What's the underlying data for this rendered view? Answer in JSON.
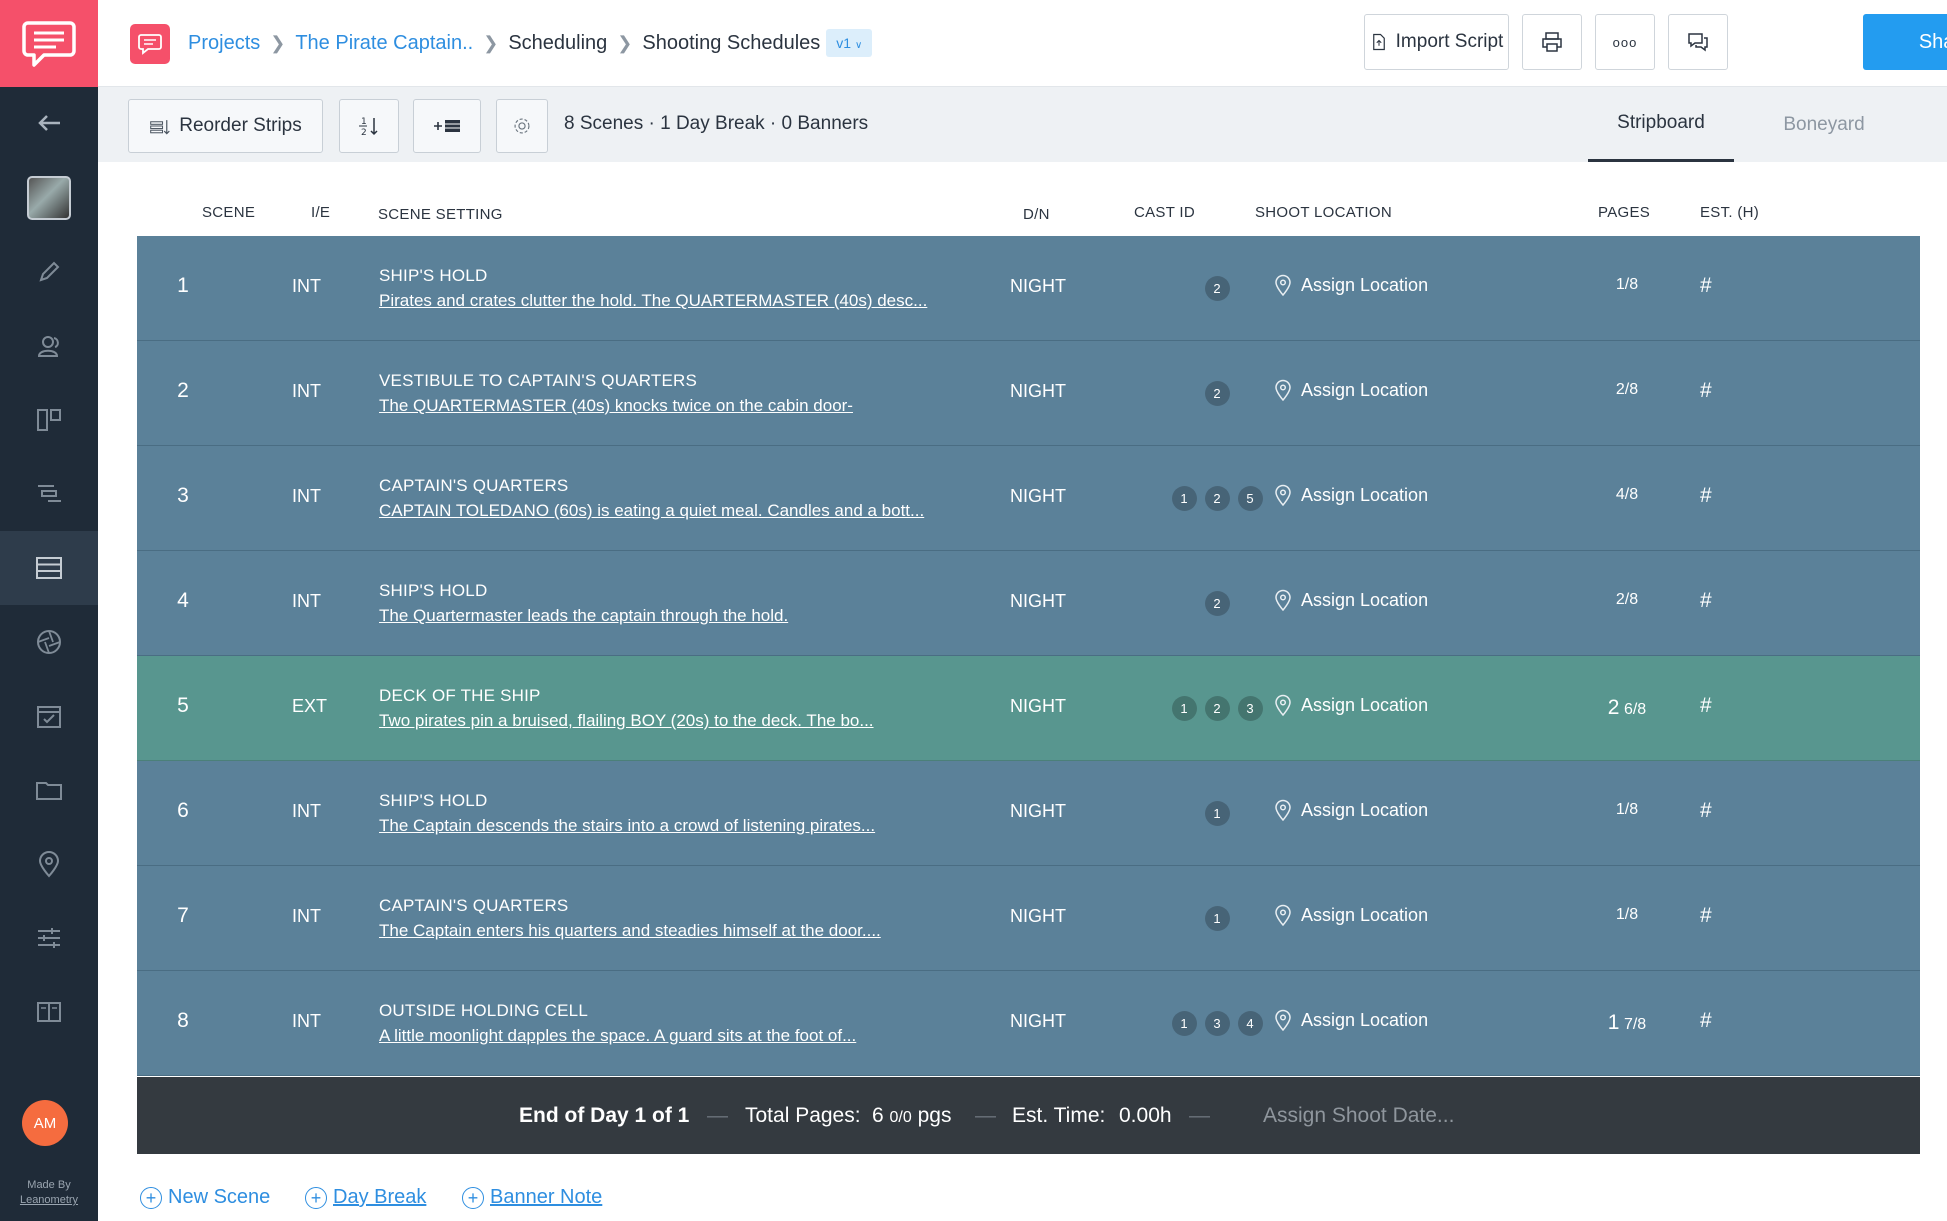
{
  "sidebar": {
    "avatar_initials": "AM",
    "made_by": "Made By",
    "maker": "Leanometry",
    "icons": [
      "back-arrow-icon",
      "project-thumbnail",
      "pencil-icon",
      "users-icon",
      "storyboard-icon",
      "timeline-icon",
      "stripboard-icon",
      "aperture-icon",
      "calendar-icon",
      "folder-icon",
      "location-pin-icon",
      "sliders-icon",
      "book-icon"
    ]
  },
  "header": {
    "breadcrumbs": [
      "Projects",
      "The Pirate Captain..",
      "Scheduling",
      "Shooting Schedules"
    ],
    "version": "v1",
    "import_label": "Import Script",
    "more_label": "ooo",
    "share_label": "Share"
  },
  "toolbar": {
    "reorder_label": "Reorder Strips",
    "summary": "8 Scenes · 1 Day Break · 0 Banners",
    "tabs": [
      "Stripboard",
      "Boneyard"
    ],
    "active_tab": "Stripboard"
  },
  "columns": {
    "scene": "SCENE",
    "ie": "I/E",
    "setting": "SCENE SETTING",
    "dn": "D/N",
    "cast": "CAST ID",
    "location": "SHOOT LOCATION",
    "pages": "PAGES",
    "est": "EST. (H)"
  },
  "scenes": [
    {
      "num": "1",
      "ie": "INT",
      "heading": "SHIP'S HOLD",
      "desc": "Pirates and crates clutter the hold. The QUARTERMASTER (40s) desc...",
      "dn": "NIGHT",
      "cast": [
        "2"
      ],
      "location": "Assign Location",
      "pages_whole": "",
      "pages_frac": "1/8",
      "est": "#"
    },
    {
      "num": "2",
      "ie": "INT",
      "heading": "VESTIBULE TO CAPTAIN'S QUARTERS",
      "desc": "The QUARTERMASTER (40s) knocks twice on the cabin door-",
      "dn": "NIGHT",
      "cast": [
        "2"
      ],
      "location": "Assign Location",
      "pages_whole": "",
      "pages_frac": "2/8",
      "est": "#"
    },
    {
      "num": "3",
      "ie": "INT",
      "heading": "CAPTAIN'S QUARTERS",
      "desc": "CAPTAIN TOLEDANO (60s) is eating a quiet meal. Candles and a bott...",
      "dn": "NIGHT",
      "cast": [
        "1",
        "2",
        "5"
      ],
      "location": "Assign Location",
      "pages_whole": "",
      "pages_frac": "4/8",
      "est": "#"
    },
    {
      "num": "4",
      "ie": "INT",
      "heading": "SHIP'S HOLD",
      "desc": "The Quartermaster leads the captain through the hold.",
      "dn": "NIGHT",
      "cast": [
        "2"
      ],
      "location": "Assign Location",
      "pages_whole": "",
      "pages_frac": "2/8",
      "est": "#"
    },
    {
      "num": "5",
      "ie": "EXT",
      "heading": "DECK OF THE SHIP",
      "desc": "Two pirates pin a bruised, flailing BOY (20s) to the deck. The bo...",
      "dn": "NIGHT",
      "cast": [
        "1",
        "2",
        "3"
      ],
      "location": "Assign Location",
      "pages_whole": "2",
      "pages_frac": "6/8",
      "est": "#"
    },
    {
      "num": "6",
      "ie": "INT",
      "heading": "SHIP'S HOLD",
      "desc": "The Captain descends the stairs into a crowd of listening pirates...",
      "dn": "NIGHT",
      "cast": [
        "1"
      ],
      "location": "Assign Location",
      "pages_whole": "",
      "pages_frac": "1/8",
      "est": "#"
    },
    {
      "num": "7",
      "ie": "INT",
      "heading": "CAPTAIN'S QUARTERS",
      "desc": "The Captain enters his quarters and steadies himself at the door....",
      "dn": "NIGHT",
      "cast": [
        "1"
      ],
      "location": "Assign Location",
      "pages_whole": "",
      "pages_frac": "1/8",
      "est": "#"
    },
    {
      "num": "8",
      "ie": "INT",
      "heading": "OUTSIDE HOLDING CELL",
      "desc": "A little moonlight dapples the space. A guard sits at the foot of...",
      "dn": "NIGHT",
      "cast": [
        "1",
        "3",
        "4"
      ],
      "location": "Assign Location",
      "pages_whole": "1",
      "pages_frac": "7/8",
      "est": "#"
    }
  ],
  "day_break": {
    "end_label": "End of Day 1 of 1",
    "total_pages_label": "Total Pages:",
    "total_pages_whole": "6",
    "total_pages_frac": "0/0",
    "total_pages_unit": "pgs",
    "est_time_label": "Est. Time:",
    "est_time_value": "0.00h",
    "assign_date": "Assign Shoot Date..."
  },
  "footer": {
    "new_scene": "New Scene",
    "day_break": "Day Break",
    "banner_note": "Banner Note"
  },
  "colors": {
    "strip_int": "#5b8199",
    "strip_ext": "#58968f",
    "day_break": "#343a40",
    "accent": "#239cf0",
    "brand": "#f5506a"
  }
}
